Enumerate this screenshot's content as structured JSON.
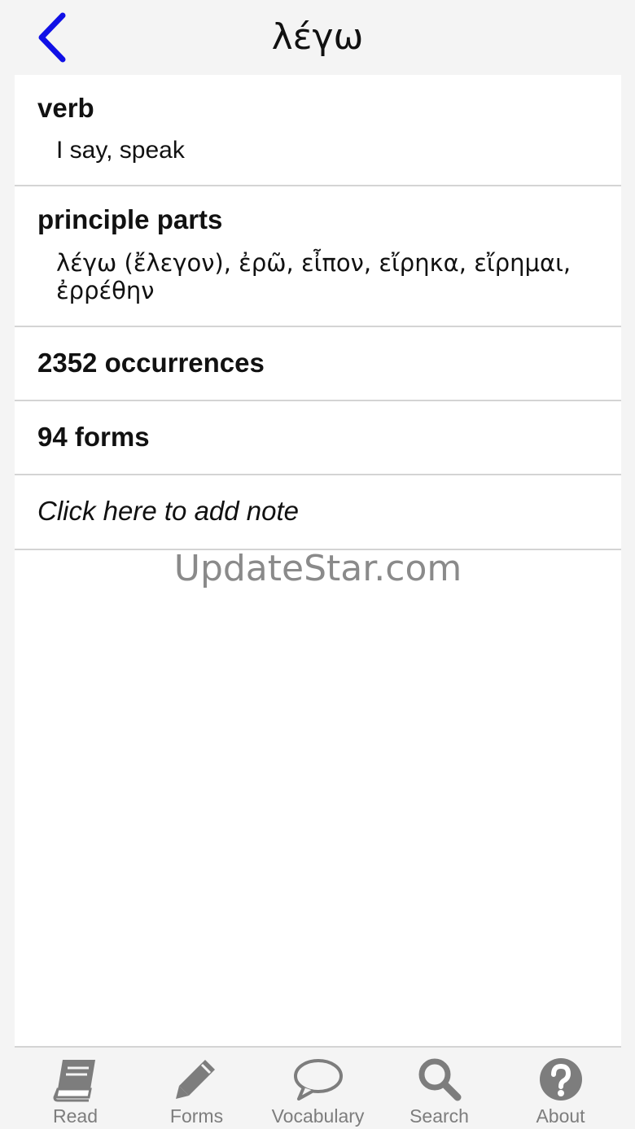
{
  "header": {
    "title": "λέγω",
    "back_icon": "chevron-left-icon",
    "accent_color": "#1010e6"
  },
  "entry": {
    "part_of_speech": "verb",
    "meaning": "I say, speak",
    "principal_parts_label": "principle parts",
    "principal_parts": "λέγω (ἔλεγον), ἐρῶ, εἶπον, εἴρηκα, εἴρημαι, ἐρρέθην",
    "occurrences": "2352 occurrences",
    "forms": "94 forms",
    "note_prompt": "Click here to add note"
  },
  "watermark": "UpdateStar.com",
  "tabs": [
    {
      "label": "Read",
      "icon": "book-icon"
    },
    {
      "label": "Forms",
      "icon": "pencil-icon"
    },
    {
      "label": "Vocabulary",
      "icon": "speech-bubble-icon"
    },
    {
      "label": "Search",
      "icon": "magnifier-icon"
    },
    {
      "label": "About",
      "icon": "question-circle-icon"
    }
  ],
  "colors": {
    "tab_icon": "#7d7d7d",
    "divider": "#d4d4d4"
  }
}
